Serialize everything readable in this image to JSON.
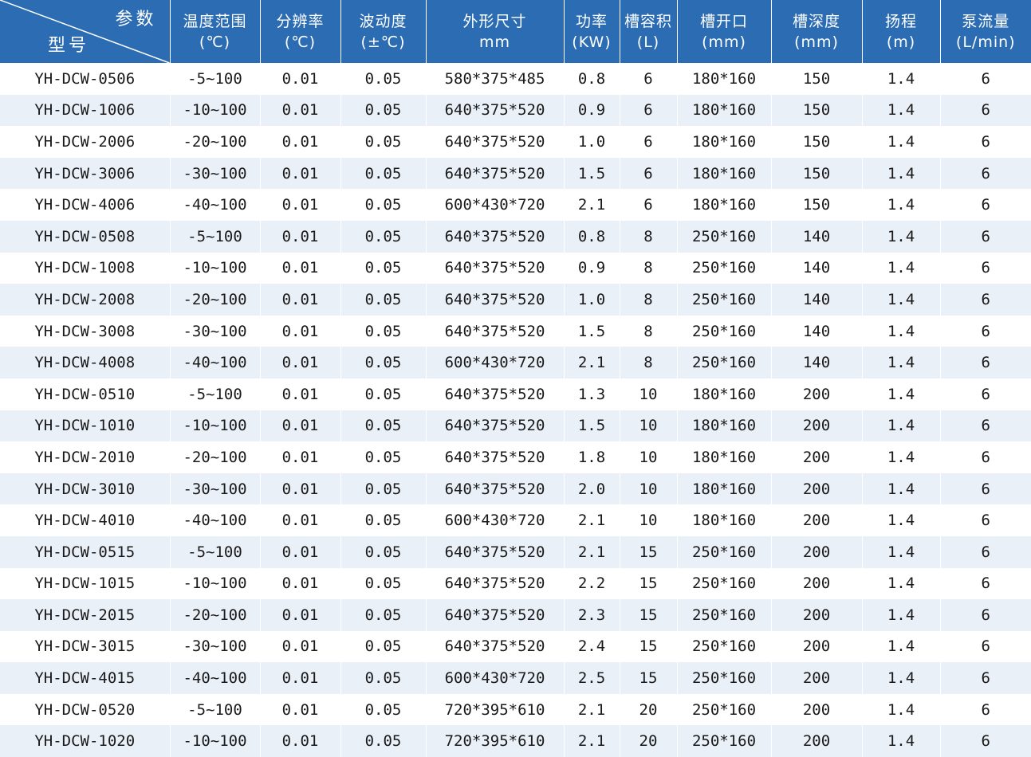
{
  "header": {
    "corner_top": "参数",
    "corner_bottom": "型号",
    "columns": [
      {
        "line1": "温度范围",
        "line2": "(℃)"
      },
      {
        "line1": "分辨率",
        "line2": "(℃)"
      },
      {
        "line1": "波动度",
        "line2": "(±℃)"
      },
      {
        "line1": "外形尺寸",
        "line2": "mm"
      },
      {
        "line1": "功率",
        "line2": "(KW)"
      },
      {
        "line1": "槽容积",
        "line2": "(L)"
      },
      {
        "line1": "槽开口",
        "line2": "(mm)"
      },
      {
        "line1": "槽深度",
        "line2": "(mm)"
      },
      {
        "line1": "扬程",
        "line2": "(m)"
      },
      {
        "line1": "泵流量",
        "line2": "(L/min)"
      }
    ]
  },
  "rows": [
    [
      "YH-DCW-0506",
      "-5~100",
      "0.01",
      "0.05",
      "580*375*485",
      "0.8",
      "6",
      "180*160",
      "150",
      "1.4",
      "6"
    ],
    [
      "YH-DCW-1006",
      "-10~100",
      "0.01",
      "0.05",
      "640*375*520",
      "0.9",
      "6",
      "180*160",
      "150",
      "1.4",
      "6"
    ],
    [
      "YH-DCW-2006",
      "-20~100",
      "0.01",
      "0.05",
      "640*375*520",
      "1.0",
      "6",
      "180*160",
      "150",
      "1.4",
      "6"
    ],
    [
      "YH-DCW-3006",
      "-30~100",
      "0.01",
      "0.05",
      "640*375*520",
      "1.5",
      "6",
      "180*160",
      "150",
      "1.4",
      "6"
    ],
    [
      "YH-DCW-4006",
      "-40~100",
      "0.01",
      "0.05",
      "600*430*720",
      "2.1",
      "6",
      "180*160",
      "150",
      "1.4",
      "6"
    ],
    [
      "YH-DCW-0508",
      "-5~100",
      "0.01",
      "0.05",
      "640*375*520",
      "0.8",
      "8",
      "250*160",
      "140",
      "1.4",
      "6"
    ],
    [
      "YH-DCW-1008",
      "-10~100",
      "0.01",
      "0.05",
      "640*375*520",
      "0.9",
      "8",
      "250*160",
      "140",
      "1.4",
      "6"
    ],
    [
      "YH-DCW-2008",
      "-20~100",
      "0.01",
      "0.05",
      "640*375*520",
      "1.0",
      "8",
      "250*160",
      "140",
      "1.4",
      "6"
    ],
    [
      "YH-DCW-3008",
      "-30~100",
      "0.01",
      "0.05",
      "640*375*520",
      "1.5",
      "8",
      "250*160",
      "140",
      "1.4",
      "6"
    ],
    [
      "YH-DCW-4008",
      "-40~100",
      "0.01",
      "0.05",
      "600*430*720",
      "2.1",
      "8",
      "250*160",
      "140",
      "1.4",
      "6"
    ],
    [
      "YH-DCW-0510",
      "-5~100",
      "0.01",
      "0.05",
      "640*375*520",
      "1.3",
      "10",
      "180*160",
      "200",
      "1.4",
      "6"
    ],
    [
      "YH-DCW-1010",
      "-10~100",
      "0.01",
      "0.05",
      "640*375*520",
      "1.5",
      "10",
      "180*160",
      "200",
      "1.4",
      "6"
    ],
    [
      "YH-DCW-2010",
      "-20~100",
      "0.01",
      "0.05",
      "640*375*520",
      "1.8",
      "10",
      "180*160",
      "200",
      "1.4",
      "6"
    ],
    [
      "YH-DCW-3010",
      "-30~100",
      "0.01",
      "0.05",
      "640*375*520",
      "2.0",
      "10",
      "180*160",
      "200",
      "1.4",
      "6"
    ],
    [
      "YH-DCW-4010",
      "-40~100",
      "0.01",
      "0.05",
      "600*430*720",
      "2.1",
      "10",
      "180*160",
      "200",
      "1.4",
      "6"
    ],
    [
      "YH-DCW-0515",
      "-5~100",
      "0.01",
      "0.05",
      "640*375*520",
      "2.1",
      "15",
      "250*160",
      "200",
      "1.4",
      "6"
    ],
    [
      "YH-DCW-1015",
      "-10~100",
      "0.01",
      "0.05",
      "640*375*520",
      "2.2",
      "15",
      "250*160",
      "200",
      "1.4",
      "6"
    ],
    [
      "YH-DCW-2015",
      "-20~100",
      "0.01",
      "0.05",
      "640*375*520",
      "2.3",
      "15",
      "250*160",
      "200",
      "1.4",
      "6"
    ],
    [
      "YH-DCW-3015",
      "-30~100",
      "0.01",
      "0.05",
      "640*375*520",
      "2.4",
      "15",
      "250*160",
      "200",
      "1.4",
      "6"
    ],
    [
      "YH-DCW-4015",
      "-40~100",
      "0.01",
      "0.05",
      "600*430*720",
      "2.5",
      "15",
      "250*160",
      "200",
      "1.4",
      "6"
    ],
    [
      "YH-DCW-0520",
      "-5~100",
      "0.01",
      "0.05",
      "720*395*610",
      "2.1",
      "20",
      "250*160",
      "200",
      "1.4",
      "6"
    ],
    [
      "YH-DCW-1020",
      "-10~100",
      "0.01",
      "0.05",
      "720*395*610",
      "2.1",
      "20",
      "250*160",
      "200",
      "1.4",
      "6"
    ]
  ],
  "colors": {
    "header_bg": "#2b6cb3",
    "header_text": "#ffffff",
    "stripe": "#eaf0f8",
    "text": "#1a1a1a"
  }
}
